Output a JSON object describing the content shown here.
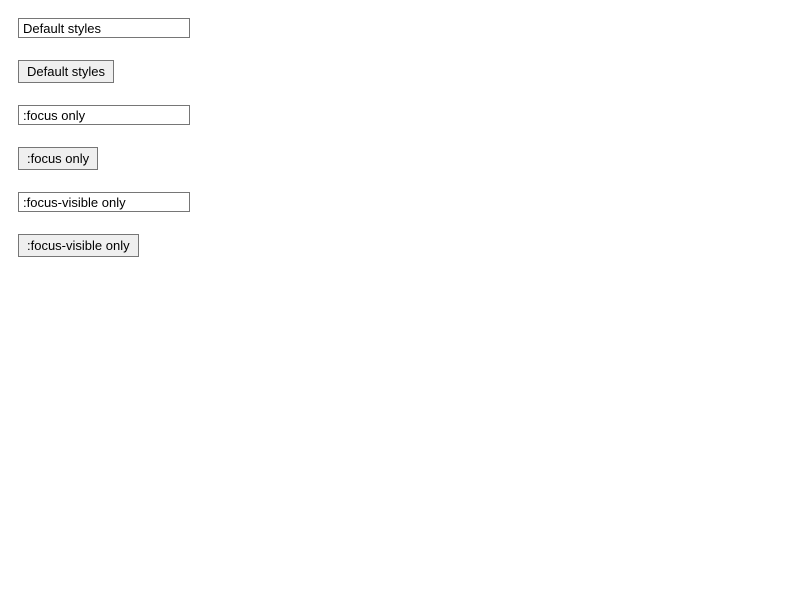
{
  "pairs": [
    {
      "input_value": "Default styles",
      "button_label": "Default styles"
    },
    {
      "input_value": ":focus only",
      "button_label": ":focus only"
    },
    {
      "input_value": ":focus-visible only",
      "button_label": ":focus-visible only"
    }
  ]
}
